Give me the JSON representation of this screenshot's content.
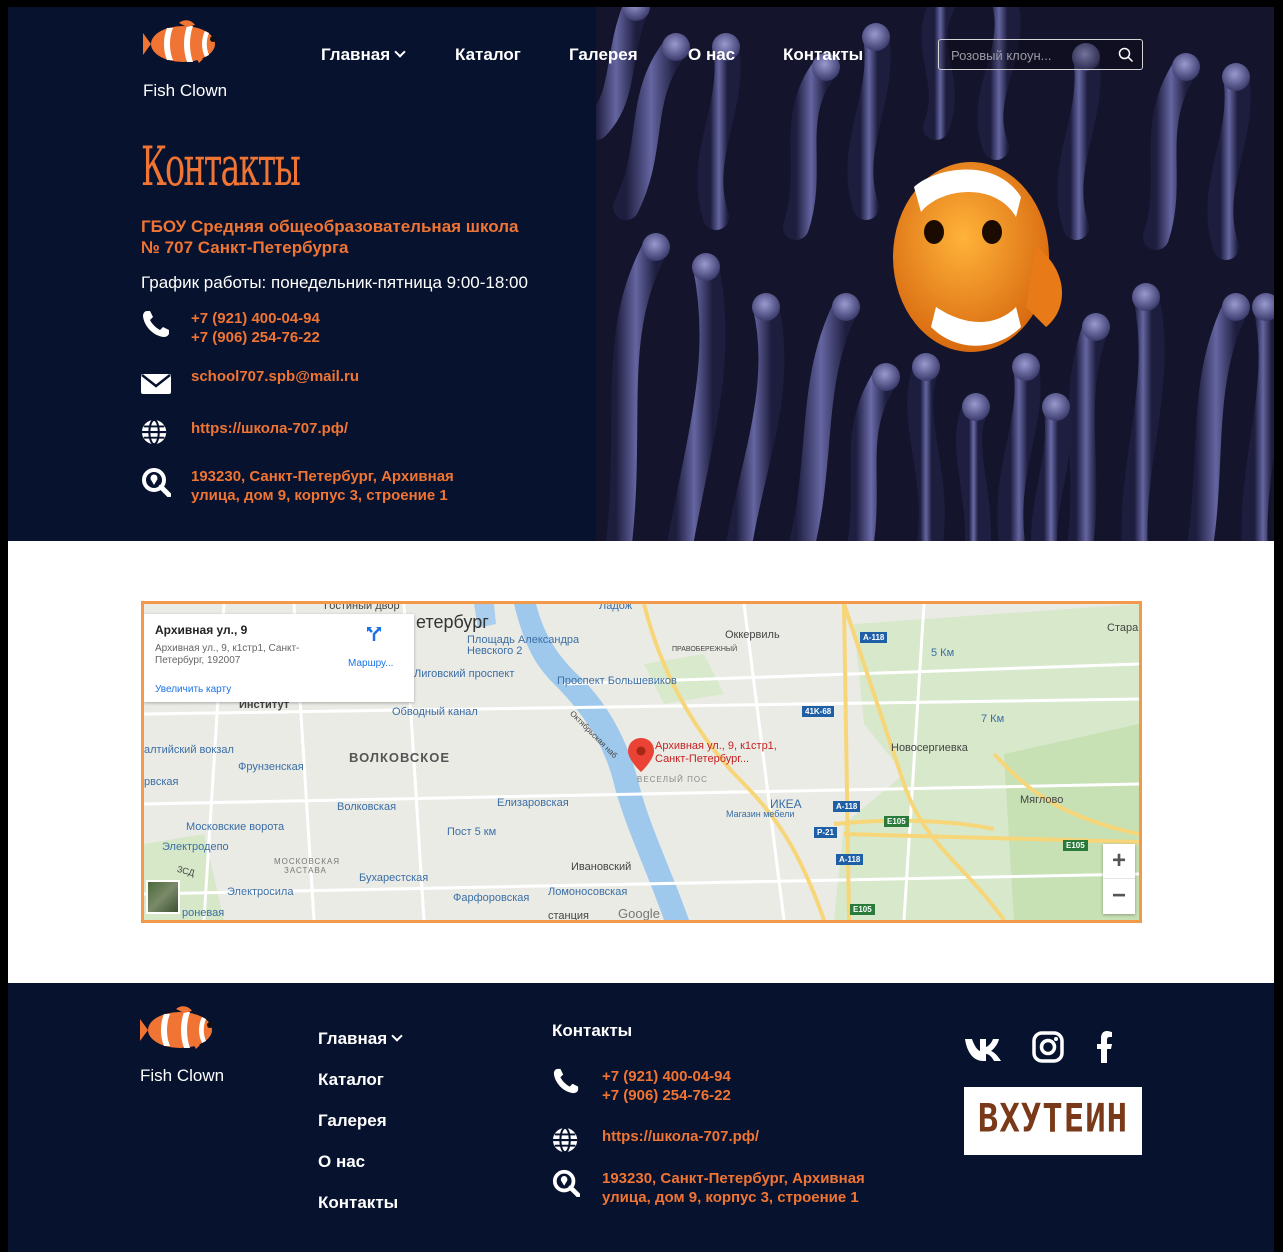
{
  "brand": {
    "name": "Fish Clown"
  },
  "nav": {
    "items": [
      {
        "label": "Главная",
        "has_dropdown": true
      },
      {
        "label": "Каталог"
      },
      {
        "label": "Галерея"
      },
      {
        "label": "О нас"
      },
      {
        "label": "Контакты"
      }
    ]
  },
  "search": {
    "placeholder": "Розовый клоун..."
  },
  "contacts": {
    "title": "Контакты",
    "school": "ГБОУ Средняя общеобразовательная школа № 707 Санкт-Петербурга",
    "hours": "График работы: понедельник-пятница 9:00-18:00",
    "phone1": "+7 (921) 400-04-94",
    "phone2": "+7 (906) 254-76-22",
    "email": "school707.spb@mail.ru",
    "website": "https://школа-707.рф/",
    "address": "193230, Санкт-Петербург, Архивная улица, дом 9, корпус 3, строение 1",
    "address_line1": "193230, Санкт-Петербург, Архивная",
    "address_line2": "улица, дом 9, корпус 3, строение 1"
  },
  "map": {
    "card_title": "Архивная ул., 9",
    "card_address": "Архивная ул., 9, к1стр1, Санкт-Петербург, 192007",
    "card_zoom": "Увеличить карту",
    "card_route": "Маршру...",
    "pin_label_1": "Архивная ул., 9, к1стр1,",
    "pin_label_2": "Санкт-Петербург...",
    "zoom_in": "+",
    "zoom_out": "−",
    "labels": {
      "gostiny": "Гостиный двор",
      "spb": "етербург",
      "ploshad1": "Площадь Александра",
      "ploshad2": "Невского 2",
      "ligovsky": "Лиговский проспект",
      "ladozh": "Ладож",
      "okkervil": "Оккервиль",
      "pravober": "ПРАВОБЕРЕЖНЫЙ",
      "bolshevikov": "Проспект Большевиков",
      "stara": "Стара",
      "km5": "5 Км",
      "km7": "7 Км",
      "institut": "Институт",
      "obvodny": "Обводный канал",
      "baltiysky": "алтийский вокзал",
      "frunzenskaya": "Фрунзенская",
      "rvskaya": "рвская",
      "volkovskoe": "ВОЛКОВСКОЕ",
      "oktyabrskaya": "Октябрьская наб",
      "veseliy": "ВЕСЕЛЫЙ ПОС",
      "novosergievka": "Новосергиевка",
      "volkovskaya": "Волковская",
      "elizarovskaya": "Елизаровская",
      "ikea": "ИКЕА",
      "magazin": "Магазин мебели",
      "myaglovo": "Мяглово",
      "moskovskie": "Московские ворота",
      "post5": "Пост 5 км",
      "elektrodepo": "Электродепо",
      "moskovskaya1": "МОСКОВСКАЯ",
      "moskovskaya2": "ЗАСТАВА",
      "ivanovsky": "Ивановский",
      "zsd": "ЗСД",
      "elektrosila": "Электросила",
      "buharestskaya": "Бухарестская",
      "farforovskaya": "Фарфоровская",
      "lomonosovskaya": "Ломоносовская",
      "stancia": "станция",
      "roneva": "роневая",
      "google": "Google",
      "a118": "A-118",
      "k68": "41K-68",
      "e105": "E105",
      "p21": "P-21"
    }
  },
  "footer": {
    "contacts_heading": "Контакты",
    "partner": "ВХУТЕИН"
  },
  "social": [
    "vk-icon",
    "instagram-icon",
    "facebook-icon"
  ],
  "colors": {
    "navy": "#06122e",
    "accent": "#f07433",
    "map_border": "#f29a4a"
  }
}
